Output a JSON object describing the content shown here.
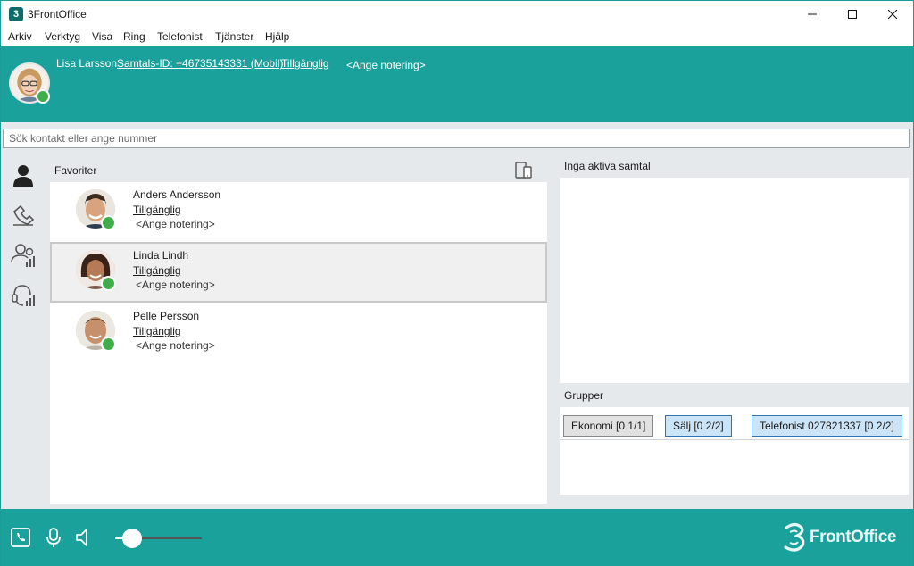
{
  "window": {
    "title": "3FrontOffice",
    "app_icon_glyph": "3",
    "controls": [
      "minimize",
      "maximize",
      "close"
    ]
  },
  "menu": [
    {
      "label": "Arkiv"
    },
    {
      "label": "Verktyg"
    },
    {
      "label": "Visa"
    },
    {
      "label": "Ring"
    },
    {
      "label": "Telefonist"
    },
    {
      "label": "Tjänster"
    },
    {
      "label": "Hjälp"
    }
  ],
  "header": {
    "user_name": "Lisa Larsson",
    "call_id": "Samtals-ID: +46735143331 (Mobil)",
    "status": "Tillgänglig",
    "note": "<Ange notering>",
    "status_color": "#3fae49"
  },
  "search": {
    "placeholder": "Sök kontakt eller ange nummer"
  },
  "favorites": {
    "title": "Favoriter",
    "contacts": [
      {
        "name": "Anders Andersson",
        "status": "Tillgänglig",
        "note": "<Ange notering>",
        "selected": false
      },
      {
        "name": "Linda Lindh",
        "status": "Tillgänglig",
        "note": "<Ange notering>",
        "selected": true
      },
      {
        "name": "Pelle Persson",
        "status": "Tillgänglig",
        "note": "<Ange notering>",
        "selected": false
      }
    ]
  },
  "calls": {
    "title": "Inga aktiva samtal"
  },
  "groups": {
    "title": "Grupper",
    "buttons": [
      {
        "label": "Ekonomi [0 1/1]",
        "active": false
      },
      {
        "label": "Sälj [0 2/2]",
        "active": true
      },
      {
        "label": "Telefonist 027821337 [0 2/2]",
        "active": true
      }
    ]
  },
  "footer": {
    "volume_level": 0.2,
    "brand": "FrontOffice"
  },
  "colors": {
    "accent": "#1aa19b",
    "available": "#3fae49"
  }
}
